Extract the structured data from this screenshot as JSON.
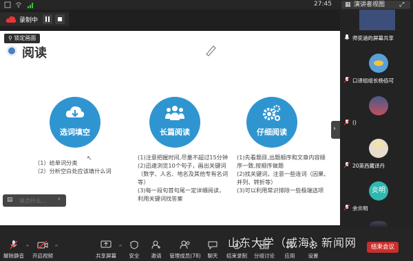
{
  "status": {
    "time": "27:45",
    "view_label": "演讲者视图"
  },
  "recording": {
    "label": "录制中"
  },
  "lock_tag": "锁定画面",
  "slide": {
    "title": "阅读",
    "features": [
      {
        "title": "选词填空",
        "icon": "download-cloud-icon",
        "desc": "（1）给单词分类\n（2）分析空白处应该填什么词"
      },
      {
        "title": "长篇阅读",
        "icon": "people-icon",
        "desc": "(1)注意把握时间,尽量不超过15分钟\n(2)迅速浏览10个句子，画出关键词（数字、人名、地名及其他专有名词等）\n(3)每一段句首句尾一定详细阅读，利用关键词找答案"
      },
      {
        "title": "仔细阅读",
        "icon": "gears-icon",
        "desc": "(1)先看题目,出题顺序和文章内容顺序一致,按顺序做题\n(2)找关键词，注意一些连词（因果、并列、转折等）\n(3)可以利用常识排除一些极端选项"
      }
    ]
  },
  "comment": {
    "placeholder": "说点什么..."
  },
  "participants": [
    {
      "label": "师奕涵的屏幕共享",
      "avatar": "screen-share"
    },
    {
      "label": "口译组组长杨佰可",
      "avatar": "duck"
    },
    {
      "label": "()",
      "avatar": "landscape"
    },
    {
      "label": "20英西藏译丹",
      "avatar": "anime-girl"
    },
    {
      "label": "余炎明",
      "avatar_text": "炎明",
      "color": "#2eb8b0"
    },
    {
      "label": "",
      "avatar": "landscape-2"
    }
  ],
  "toolbar": {
    "items": [
      {
        "label": "解除静音",
        "icon": "mic-muted-icon"
      },
      {
        "label": "开启视频",
        "icon": "camera-off-icon"
      },
      {
        "label": "共享屏幕",
        "icon": "screen-share-icon"
      },
      {
        "label": "安全",
        "icon": "shield-icon"
      },
      {
        "label": "邀请",
        "icon": "invite-icon"
      },
      {
        "label": "管理成员(78)",
        "icon": "members-icon"
      },
      {
        "label": "聊天",
        "icon": "chat-icon"
      },
      {
        "label": "结束录制",
        "icon": "stop-record-icon"
      },
      {
        "label": "分组讨论",
        "icon": "breakout-icon"
      },
      {
        "label": "应用",
        "icon": "apps-icon"
      },
      {
        "label": "设置",
        "icon": "settings-icon"
      }
    ],
    "end_label": "结束会议"
  },
  "watermark": "山东大学（威海）新闻网",
  "colors": {
    "accent": "#2f95d1",
    "end_red": "#c9302c",
    "background": "#1f1f1f"
  }
}
